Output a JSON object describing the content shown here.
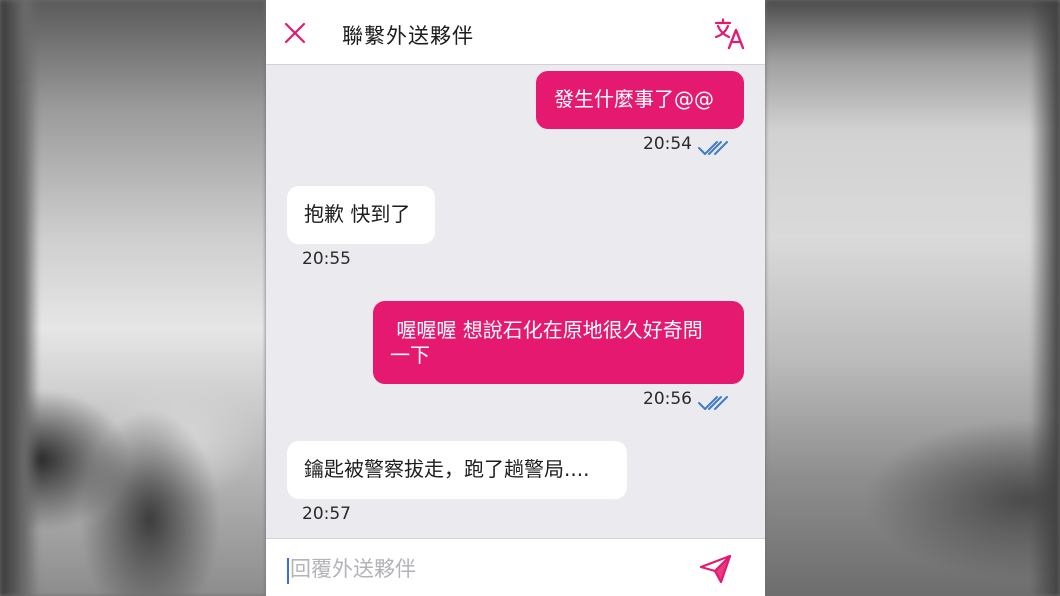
{
  "header": {
    "title": "聯繫外送夥伴",
    "close_icon": "close-icon",
    "translate_icon": "translate-icon"
  },
  "messages": [
    {
      "direction": "outgoing",
      "text": "發生什麼事了@@",
      "time": "20:54",
      "read": true
    },
    {
      "direction": "incoming",
      "text": "抱歉 快到了",
      "time": "20:55"
    },
    {
      "direction": "outgoing",
      "text_lines": [
        " 喔喔喔 想說石化在原地很久好奇問",
        "一下"
      ],
      "time": "20:56",
      "read": true
    },
    {
      "direction": "incoming",
      "text": "鑰匙被警察拔走，跑了趟警局....",
      "time": "20:57"
    }
  ],
  "composer": {
    "placeholder": "回覆外送夥伴",
    "value": "",
    "send_icon": "send-icon"
  },
  "colors": {
    "accent": "#e4196f",
    "background": "#ebeaef",
    "read_ticks": "#3f7cc4"
  }
}
